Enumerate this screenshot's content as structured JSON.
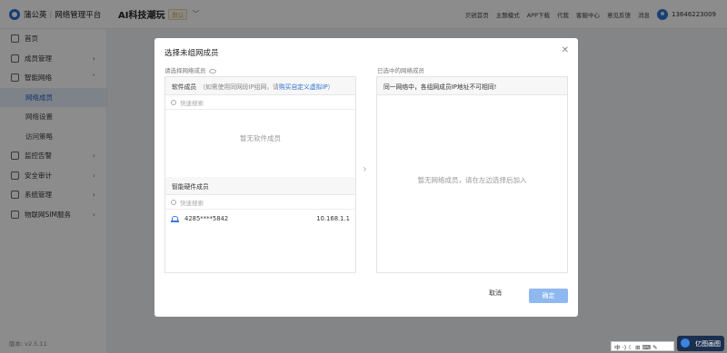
{
  "app": {
    "logo_text": "蒲公英",
    "logo_subtitle": "网络管理平台",
    "network_name": "AI科技潮玩",
    "network_badge": "默认"
  },
  "topnav": {
    "items": [
      "贝锐首页",
      "主题模式",
      "APP下载",
      "代我",
      "客服中心",
      "意见反馈",
      "消息"
    ],
    "username": "13646223009"
  },
  "sidebar": {
    "items": [
      {
        "label": "首页",
        "icon": "home-icon"
      },
      {
        "label": "成员管理",
        "icon": "user-icon"
      },
      {
        "label": "智能网络",
        "icon": "network-icon"
      }
    ],
    "subitems": [
      "网络成员",
      "网络设置",
      "访问策略"
    ],
    "items_after": [
      {
        "label": "监控告警",
        "icon": "monitor-icon"
      },
      {
        "label": "安全审计",
        "icon": "security-icon"
      },
      {
        "label": "系统管理",
        "icon": "settings-icon"
      },
      {
        "label": "物联网SIM服务",
        "icon": "sim-icon"
      }
    ],
    "version": "版本: v2.5.11"
  },
  "modal": {
    "title": "选择未组网成员",
    "left_label": "请选择网络成员",
    "right_label": "已选中的网络成员",
    "software": {
      "title": "软件成员",
      "hint": "（如需使用同网段IP组网，请",
      "link": "购买自定义虚拟IP",
      "hint_end": "）",
      "search_placeholder": "快速搜索",
      "empty": "暂无软件成员"
    },
    "hardware": {
      "title": "智能硬件成员",
      "search_placeholder": "快速搜索",
      "devices": [
        {
          "name": "4285****5842",
          "ip": "10.168.1.1"
        }
      ]
    },
    "selected": {
      "notice": "同一网络中，各组网成员IP地址不可相同!",
      "empty": "暂无网络成员，请在左边选择后加入"
    },
    "cancel_label": "取消",
    "ok_label": "确定"
  },
  "taskbar": {
    "ime_text": "中 ·) ☾ ⊞ ⌨ ✎",
    "watermark": "亿图画图"
  },
  "colors": {
    "accent": "#2b6fd6",
    "active_menu_bg": "#e6effb",
    "ok_button": "#8fb8f0"
  }
}
